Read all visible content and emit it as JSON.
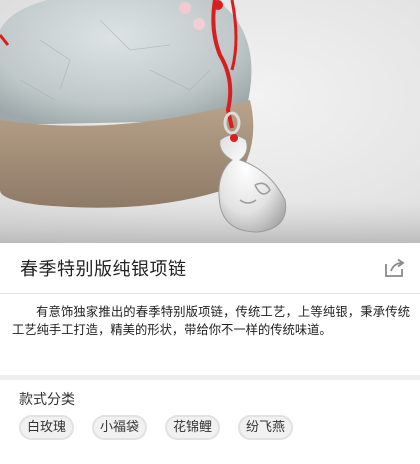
{
  "product": {
    "title": "春季特别版纯银项链",
    "description": "有意饰独家推出的春季特别版项链，传统工艺，上等纯银，秉承传统工艺纯手工打造，精美的形状，带给你不一样的传统味道。"
  },
  "hero": {
    "icon": "product-photo"
  },
  "share": {
    "icon": "share-icon"
  },
  "variants": {
    "title": "款式分类",
    "options": [
      "白玫瑰",
      "小福袋",
      "花锦鲤",
      "纷飞燕"
    ]
  },
  "colors": {
    "string_red": "#d81e1e",
    "silver": "#e8e8e8",
    "page_bg": "#ffffff"
  }
}
